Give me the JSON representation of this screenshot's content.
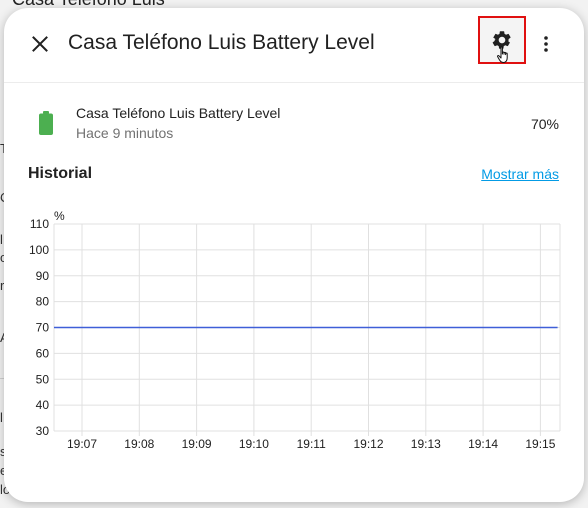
{
  "background": {
    "title": "Casa Teléfono Luis",
    "fragments": [
      "T",
      "C",
      "l",
      "ol",
      "r",
      "A",
      "l",
      "s",
      "e",
      "lo"
    ]
  },
  "dialog": {
    "title": "Casa Teléfono Luis Battery Level",
    "close_icon": "close-icon",
    "settings_icon": "gear-icon",
    "more_icon": "more-vertical-icon"
  },
  "entity": {
    "name": "Casa Teléfono Luis Battery Level",
    "last_changed": "Hace 9 minutos",
    "state": "70%",
    "icon": "battery-icon",
    "icon_color": "#4caf50"
  },
  "history": {
    "title": "Historial",
    "show_more_label": "Mostrar más"
  },
  "colors": {
    "accent": "#039be5",
    "highlight_border": "#e01010",
    "series_line": "#3f5fd8"
  },
  "chart_data": {
    "type": "line",
    "ylabel": "%",
    "ylim": [
      30,
      110
    ],
    "yticks": [
      110,
      100,
      90,
      80,
      70,
      60,
      50,
      40,
      30
    ],
    "xticks": [
      "19:07",
      "19:08",
      "19:09",
      "19:10",
      "19:11",
      "19:12",
      "19:13",
      "19:14",
      "19:15"
    ],
    "grid": true,
    "legend": "none",
    "series": [
      {
        "x": [
          "19:06.5",
          "19:15.3"
        ],
        "values": [
          70,
          70
        ]
      }
    ]
  }
}
